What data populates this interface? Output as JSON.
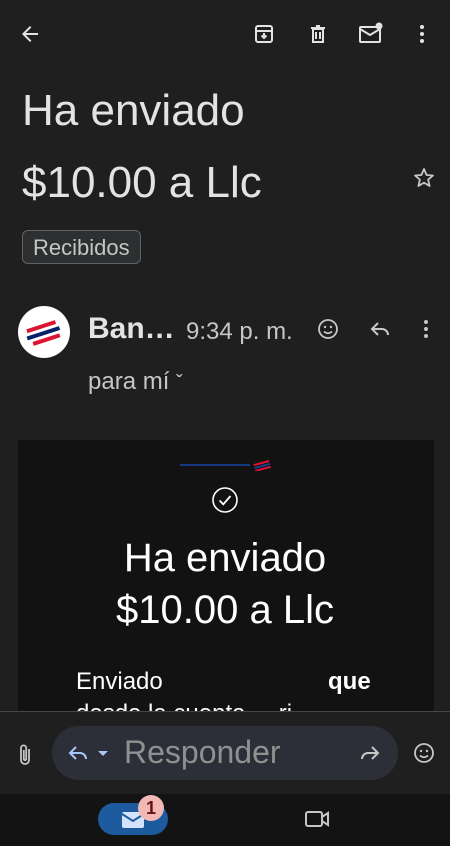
{
  "topbar": {
    "back_icon": "arrow-left-icon",
    "actions": [
      "archive-icon",
      "delete-icon",
      "mark-unread-icon",
      "more-vert-icon"
    ]
  },
  "email": {
    "subject_line1": "Ha enviado",
    "subject_line2": "$10.00 a Llc",
    "label": "Recibidos",
    "sender": "Ban…",
    "time": "9:34 p. m.",
    "recipient": "para mí",
    "recipient_chevron": "ˇ"
  },
  "card": {
    "title_line1": "Ha enviado",
    "title_line2": "$10.00 a Llc",
    "body_left": "Enviado",
    "body_right": "que",
    "body_partial": "desde la cuenta ... ri"
  },
  "reply_bar": {
    "placeholder": "Responder"
  },
  "navbar": {
    "badge_count": "1"
  },
  "colors": {
    "background": "#1f1f1f",
    "card_background": "#121212",
    "accent_blue": "#1d5a9e",
    "badge": "#f2b8b5",
    "boa_red": "#dc1431",
    "boa_blue": "#012169"
  }
}
